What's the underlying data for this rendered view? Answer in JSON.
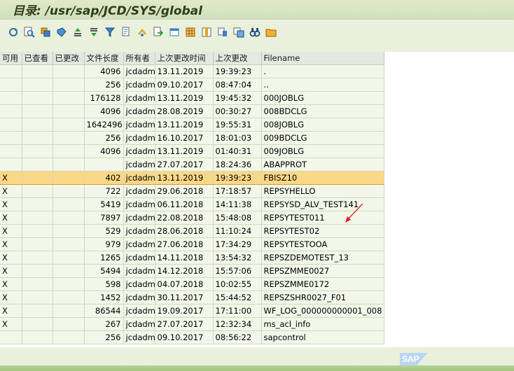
{
  "window": {
    "title": "目录: /usr/sap/JCD/SYS/global"
  },
  "toolbar": {
    "icons": [
      "refresh-icon",
      "find-icon",
      "select-icon",
      "tag-icon",
      "sort-ascending-icon",
      "sort-descending-icon",
      "filter-icon",
      "print-icon",
      "sum-icon",
      "export-icon",
      "layout-icon",
      "grid-icon",
      "columns-icon",
      "move-icon",
      "copy-icon",
      "binoculars-icon",
      "folder-icon"
    ]
  },
  "table": {
    "columns": [
      "可用",
      "已查看",
      "已更改",
      "文件长度",
      "所有者",
      "上次更改时间",
      "上次更改",
      "Filename"
    ],
    "rows": [
      [
        "",
        "",
        "",
        "4096",
        "jcdadm",
        "13.11.2019",
        "19:39:23",
        "."
      ],
      [
        "",
        "",
        "",
        "256",
        "jcdadm",
        "09.10.2017",
        "08:47:04",
        ".."
      ],
      [
        "",
        "",
        "",
        "176128",
        "jcdadm",
        "13.11.2019",
        "19:45:32",
        "000JOBLG"
      ],
      [
        "",
        "",
        "",
        "4096",
        "jcdadm",
        "28.08.2019",
        "00:30:27",
        "008BDCLG"
      ],
      [
        "",
        "",
        "",
        "1642496",
        "jcdadm",
        "13.11.2019",
        "19:55:31",
        "008JOBLG"
      ],
      [
        "",
        "",
        "",
        "256",
        "jcdadm",
        "16.10.2017",
        "18:01:03",
        "009BDCLG"
      ],
      [
        "",
        "",
        "",
        "4096",
        "jcdadm",
        "13.11.2019",
        "01:40:31",
        "009JOBLG"
      ],
      [
        "",
        "",
        "",
        "",
        "jcdadm",
        "27.07.2017",
        "18:24:36",
        "ABAPPROT"
      ],
      [
        "X",
        "",
        "",
        "402",
        "jcdadm",
        "13.11.2019",
        "19:39:23",
        "FBISZ10"
      ],
      [
        "X",
        "",
        "",
        "722",
        "jcdadm",
        "29.06.2018",
        "17:18:57",
        "REPSYHELLO"
      ],
      [
        "X",
        "",
        "",
        "5419",
        "jcdadm",
        "06.11.2018",
        "14:11:38",
        "REPSYSD_ALV_TEST141"
      ],
      [
        "X",
        "",
        "",
        "7897",
        "jcdadm",
        "22.08.2018",
        "15:48:08",
        "REPSYTEST011"
      ],
      [
        "X",
        "",
        "",
        "529",
        "jcdadm",
        "28.06.2018",
        "11:10:24",
        "REPSYTEST02"
      ],
      [
        "X",
        "",
        "",
        "979",
        "jcdadm",
        "27.06.2018",
        "17:34:29",
        "REPSYTESTOOA"
      ],
      [
        "X",
        "",
        "",
        "1265",
        "jcdadm",
        "14.11.2018",
        "13:54:32",
        "REPSZDEMOTEST_13"
      ],
      [
        "X",
        "",
        "",
        "5494",
        "jcdadm",
        "14.12.2018",
        "15:57:06",
        "REPSZMME0027"
      ],
      [
        "X",
        "",
        "",
        "598",
        "jcdadm",
        "04.07.2018",
        "10:02:55",
        "REPSZMME0172"
      ],
      [
        "X",
        "",
        "",
        "1452",
        "jcdadm",
        "30.11.2017",
        "15:44:52",
        "REPSZSHR0027_F01"
      ],
      [
        "X",
        "",
        "",
        "86544",
        "jcdadm",
        "19.09.2017",
        "17:11:00",
        "WF_LOG_000000000001_008"
      ],
      [
        "X",
        "",
        "",
        "267",
        "jcdadm",
        "27.07.2017",
        "12:32:34",
        "ms_acl_info"
      ],
      [
        "",
        "",
        "",
        "256",
        "jcdadm",
        "09.10.2017",
        "08:56:22",
        "sapcontrol"
      ]
    ],
    "selected_row": 8
  },
  "annotation": {
    "color": "#e02020"
  },
  "logo": {
    "text": "SAP"
  }
}
